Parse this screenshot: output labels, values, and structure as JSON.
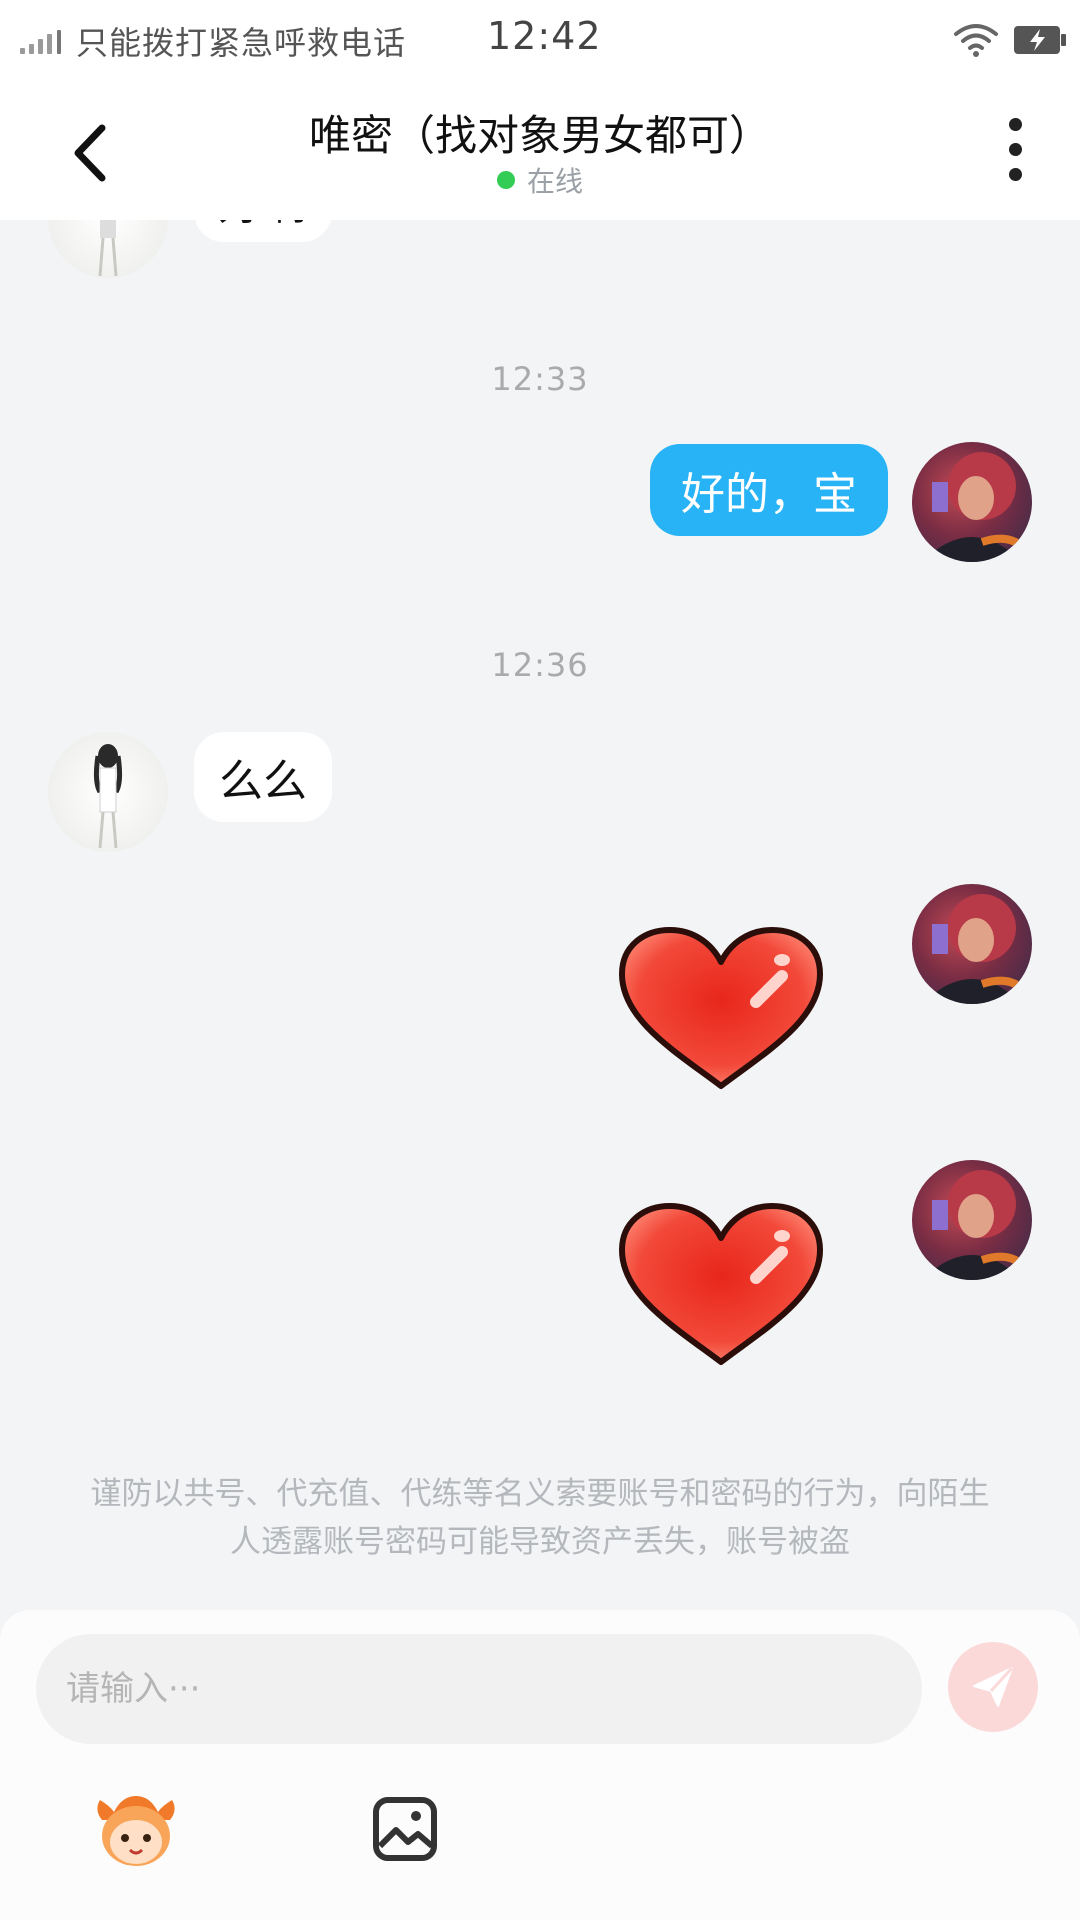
{
  "status_bar": {
    "carrier_text": "只能拨打紧急呼救电话",
    "time": "12:42",
    "icons": [
      "signal-icon",
      "wifi-icon",
      "battery-charging-icon"
    ]
  },
  "header": {
    "title": "唯密（找对象男女都可）",
    "status": "在线",
    "status_color": "#33cc55"
  },
  "chat": {
    "timestamps": [
      "12:33",
      "12:36"
    ],
    "messages": [
      {
        "from": "other",
        "text": "好啊"
      },
      {
        "from": "me",
        "text": "好的，宝"
      },
      {
        "from": "other",
        "text": "么么"
      },
      {
        "from": "me",
        "sticker": "heart-sticker"
      },
      {
        "from": "me",
        "sticker": "heart-sticker"
      }
    ],
    "outgoing_bubble_color": "#27b3f5"
  },
  "notice": {
    "text": "谨防以共号、代充值、代练等名义索要账号和密码的行为，向陌生人透露账号密码可能导致资产丢失，账号被盗"
  },
  "composer": {
    "placeholder": "请输入···",
    "send_color": "#f58a8a",
    "tools": [
      "emoji-icon",
      "image-icon"
    ]
  }
}
